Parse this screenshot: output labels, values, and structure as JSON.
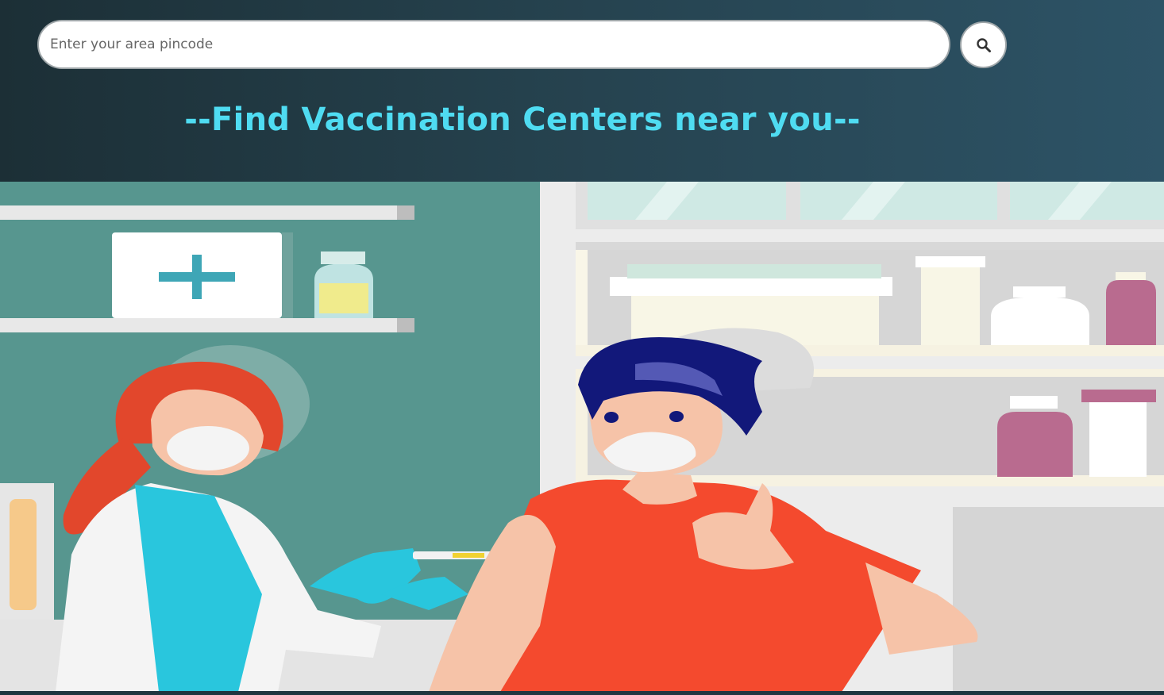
{
  "search": {
    "placeholder": "Enter your area pincode",
    "value": "",
    "button_icon": "search-icon"
  },
  "headline": "--Find Vaccination Centers near you--",
  "colors": {
    "header_start": "#1c2f36",
    "header_end": "#2d5366",
    "headline": "#4fdcf2",
    "wall_teal": "#57968f",
    "shirt_red": "#f44a2e",
    "glove_cyan": "#29c6dd"
  },
  "hero_image": {
    "icon": "vaccination-illustration"
  }
}
